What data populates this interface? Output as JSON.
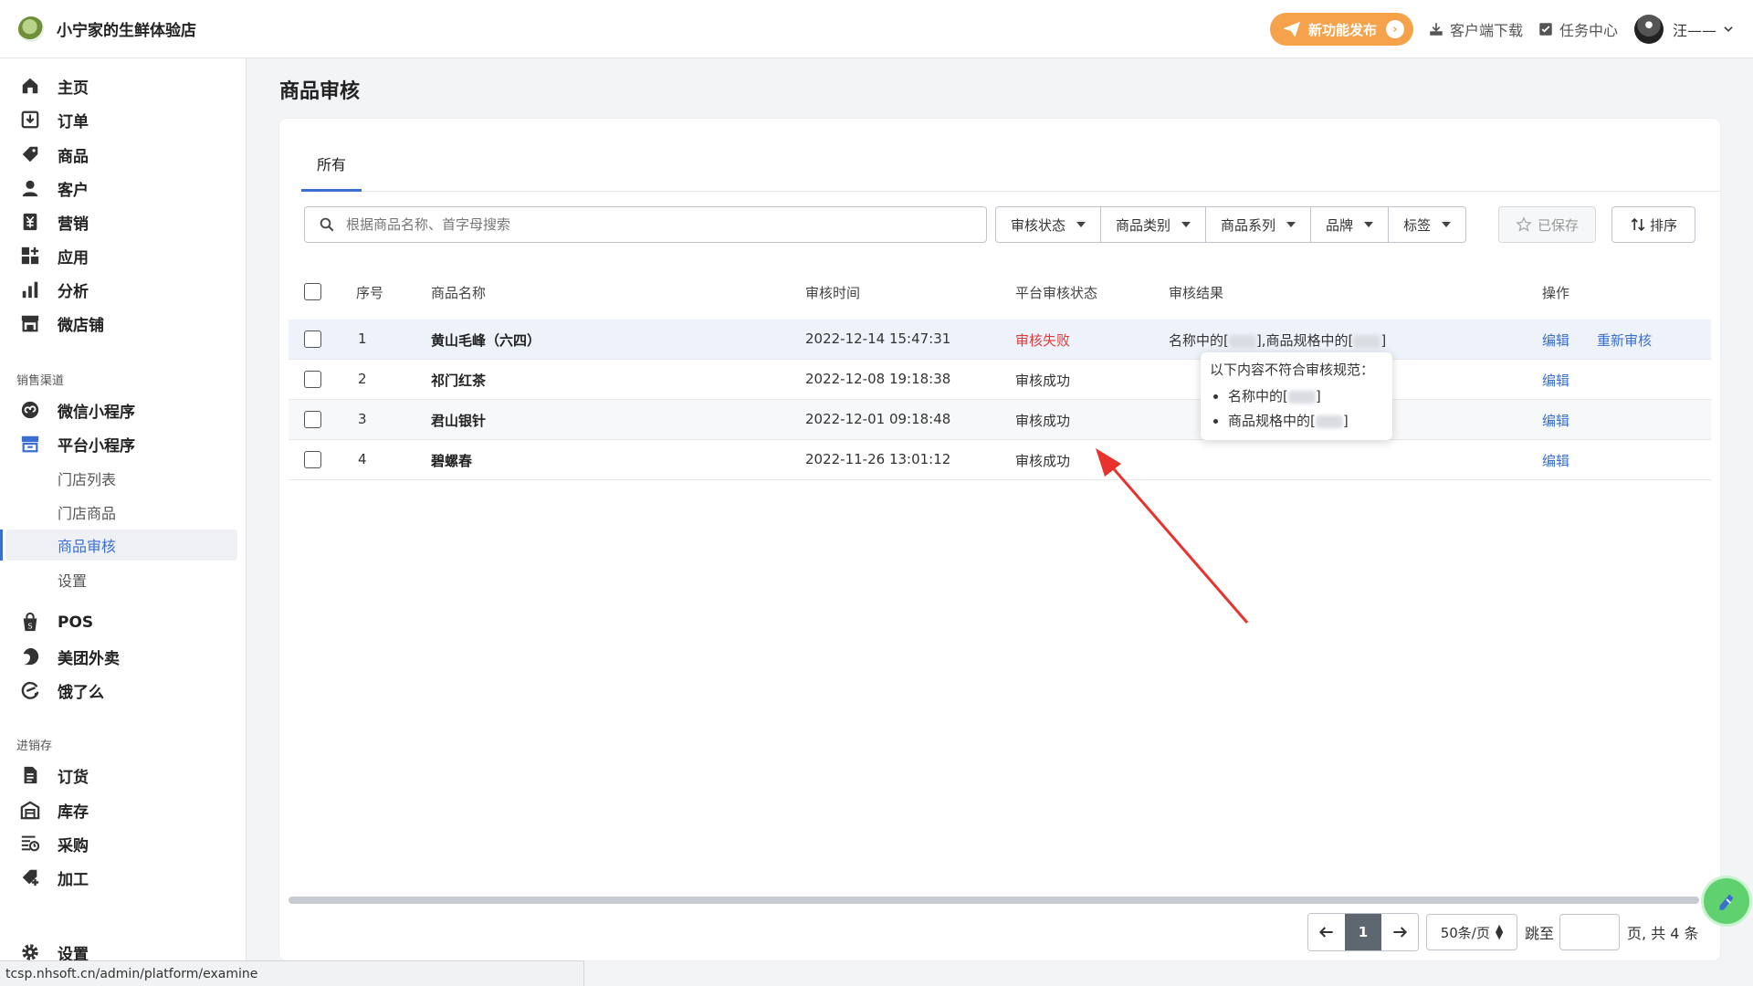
{
  "brand": {
    "name": "小宁家的生鲜体验店"
  },
  "header": {
    "new_feature": "新功能发布",
    "client_download": "客户端下载",
    "task_center": "任务中心",
    "user_name": "汪——"
  },
  "sidebar": {
    "main_items": [
      {
        "label": "主页",
        "icon": "home-icon"
      },
      {
        "label": "订单",
        "icon": "order-icon"
      },
      {
        "label": "商品",
        "icon": "tag-icon"
      },
      {
        "label": "客户",
        "icon": "user-icon"
      },
      {
        "label": "营销",
        "icon": "marketing-icon"
      },
      {
        "label": "应用",
        "icon": "apps-icon"
      },
      {
        "label": "分析",
        "icon": "chart-icon"
      },
      {
        "label": "微店铺",
        "icon": "store-icon"
      }
    ],
    "sales_section": "销售渠道",
    "sales_items": [
      {
        "label": "微信小程序",
        "icon": "wechat-icon"
      },
      {
        "label": "平台小程序",
        "icon": "platform-icon"
      }
    ],
    "platform_sub": [
      "门店列表",
      "门店商品",
      "商品审核",
      "设置"
    ],
    "sales_items_2": [
      {
        "label": "POS",
        "icon": "pos-icon"
      },
      {
        "label": "美团外卖",
        "icon": "meituan-icon"
      },
      {
        "label": "饿了么",
        "icon": "eleme-icon"
      }
    ],
    "inventory_section": "进销存",
    "inventory_items": [
      {
        "label": "订货",
        "icon": "document-icon"
      },
      {
        "label": "库存",
        "icon": "warehouse-icon"
      },
      {
        "label": "采购",
        "icon": "purchase-icon"
      },
      {
        "label": "加工",
        "icon": "process-icon"
      }
    ],
    "settings": "设置"
  },
  "page": {
    "title": "商品审核",
    "tab_all": "所有",
    "search_placeholder": "根据商品名称、首字母搜索",
    "filters": [
      "审核状态",
      "商品类别",
      "商品系列",
      "品牌",
      "标签"
    ],
    "saved": "已保存",
    "sort": "排序"
  },
  "table": {
    "headers": [
      "序号",
      "商品名称",
      "审核时间",
      "平台审核状态",
      "审核结果",
      "操作"
    ],
    "rows": [
      {
        "no": "1",
        "name": "黄山毛峰（六四）",
        "time": "2022-12-14 15:47:31",
        "status": "审核失败",
        "result_a": "名称中的[",
        "result_b": "],商品规格中的[",
        "result_c": "]",
        "edit": "编辑",
        "reaudit": "重新审核"
      },
      {
        "no": "2",
        "name": "祁门红茶",
        "time": "2022-12-08 19:18:38",
        "status": "审核成功",
        "edit": "编辑"
      },
      {
        "no": "3",
        "name": "君山银针",
        "time": "2022-12-01 09:18:48",
        "status": "审核成功",
        "edit": "编辑"
      },
      {
        "no": "4",
        "name": "碧螺春",
        "time": "2022-11-26 13:01:12",
        "status": "审核成功",
        "edit": "编辑"
      }
    ]
  },
  "tooltip": {
    "title": "以下内容不符合审核规范：",
    "item1": "名称中的[",
    "item1_end": "]",
    "item2": "商品规格中的[",
    "item2_end": "]"
  },
  "pagination": {
    "current": "1",
    "page_size": "50条/页",
    "jump_label": "跳至",
    "total": "页,   共 4 条"
  },
  "statusbar": {
    "url": "tcsp.nhsoft.cn/admin/platform/examine"
  },
  "colors": {
    "accent": "#3a6fcf",
    "fail": "#e03b3b",
    "orange": "#f5a24b",
    "arrow": "#e8322d"
  }
}
